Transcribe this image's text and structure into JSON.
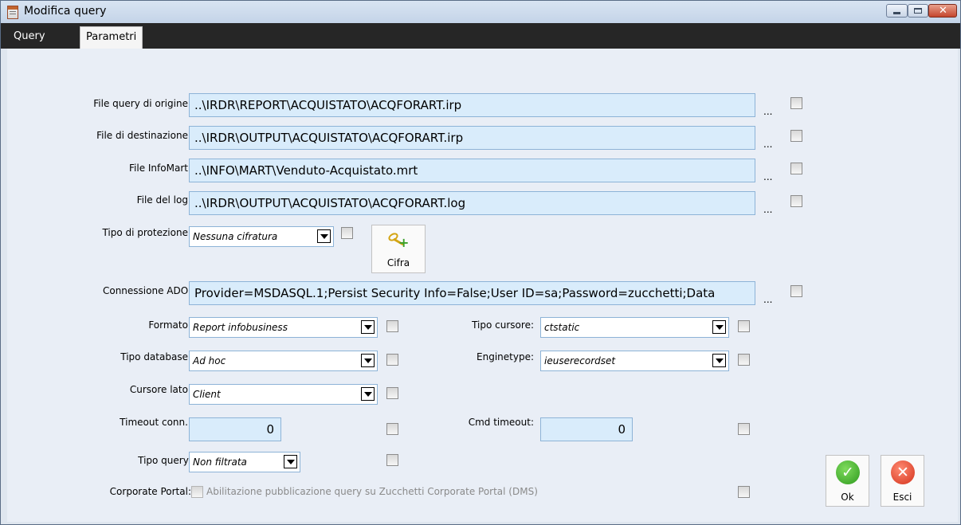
{
  "window": {
    "title": "Modifica query"
  },
  "titlebar_buttons": {
    "minimize": "minimize-icon",
    "maximize": "maximize-icon",
    "close": "✕"
  },
  "tabs": [
    "Query",
    "Parametri"
  ],
  "fields": {
    "file_query_origine": {
      "label": "File query di origine:",
      "value": "..\\IRDR\\REPORT\\ACQUISTATO\\ACQFORART.irp"
    },
    "file_destinazione": {
      "label": "File di destinazione:",
      "value": "..\\IRDR\\OUTPUT\\ACQUISTATO\\ACQFORART.irp"
    },
    "file_infomart": {
      "label": "File InfoMart:",
      "value": "..\\INFO\\MART\\Venduto-Acquistato.mrt"
    },
    "file_log": {
      "label": "File del log:",
      "value": "..\\IRDR\\OUTPUT\\ACQUISTATO\\ACQFORART.log"
    },
    "tipo_protezione": {
      "label": "Tipo di protezione:",
      "value": "Nessuna cifratura"
    },
    "connessione_ado": {
      "label": "Connessione ADO:",
      "value": "Provider=MSDASQL.1;Persist Security Info=False;User ID=sa;Password=zucchetti;Data"
    },
    "formato": {
      "label": "Formato:",
      "value": "Report infobusiness"
    },
    "tipo_cursore": {
      "label": "Tipo cursore:",
      "value": "ctstatic"
    },
    "tipo_database": {
      "label": "Tipo database:",
      "value": "Ad hoc"
    },
    "enginetype": {
      "label": "Enginetype:",
      "value": "ieuserecordset"
    },
    "cursore_lato": {
      "label": "Cursore lato:",
      "value": "Client"
    },
    "timeout_conn": {
      "label": "Timeout conn.:",
      "value": "0"
    },
    "cmd_timeout": {
      "label": "Cmd timeout:",
      "value": "0"
    },
    "tipo_query": {
      "label": "Tipo query:",
      "value": "Non filtrata"
    },
    "corporate_portal": {
      "label": "Corporate Portal:",
      "checkbox_label": "Abilitazione pubblicazione query su Zucchetti Corporate Portal (DMS)"
    }
  },
  "browse_label": "...",
  "buttons": {
    "cifra": {
      "label": "Cifra",
      "icon": "key-add-icon"
    },
    "ok": {
      "label": "Ok",
      "icon": "check-icon",
      "glyph": "✓"
    },
    "esci": {
      "label": "Esci",
      "icon": "cancel-icon",
      "glyph": "✕"
    }
  },
  "colors": {
    "field_bg": "#d9ecfb",
    "field_border": "#8db3d7",
    "tabbar": "#262626",
    "panel_bg": "#e9eef6"
  }
}
